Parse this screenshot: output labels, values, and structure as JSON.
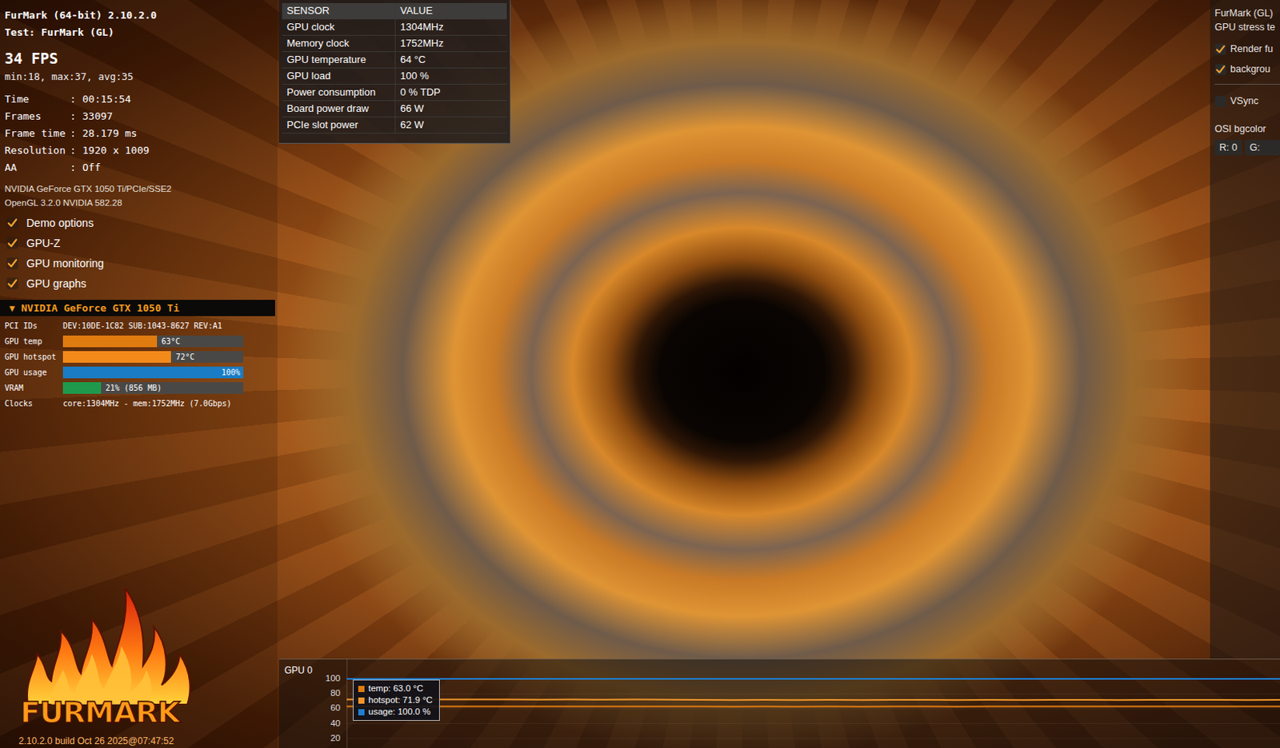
{
  "window": {
    "title": "FurMark (64-bit) 2.10.2.0",
    "test": "Test: FurMark (GL)"
  },
  "stats": {
    "fps": "34 FPS",
    "summary": "min:18, max:37, avg:35",
    "separator": ":",
    "rows": [
      {
        "label": "Time",
        "value": "00:15:54"
      },
      {
        "label": "Frames",
        "value": "33097"
      },
      {
        "label": "Frame time",
        "value": "28.179 ms"
      },
      {
        "label": "Resolution",
        "value": "1920 x 1009"
      },
      {
        "label": "AA",
        "value": "Off"
      }
    ]
  },
  "gpu_info": [
    "NVIDIA GeForce GTX 1050 Ti/PCIe/SSE2",
    "OpenGL 3.2.0 NVIDIA 582.28"
  ],
  "options": [
    {
      "label": "Demo options",
      "checked": true
    },
    {
      "label": "GPU-Z",
      "checked": true
    },
    {
      "label": "GPU monitoring",
      "checked": true
    },
    {
      "label": "GPU graphs",
      "checked": true
    }
  ],
  "gpu_panel": {
    "expand_icon": "▼",
    "title": "NVIDIA GeForce GTX 1050 Ti",
    "pci": {
      "label": "PCI IDs",
      "value": "DEV:10DE-1C82 SUB:1043-8627 REV:A1"
    },
    "bars": [
      {
        "label": "GPU temp",
        "reading": "63°C",
        "level": 0.52,
        "color": "#e07b10"
      },
      {
        "label": "GPU hotspot",
        "reading": "72°C",
        "level": 0.6,
        "color": "#f28a1a"
      },
      {
        "label": "GPU usage",
        "reading": "100%",
        "level": 1.0,
        "color": "#1a7cc4"
      },
      {
        "label": "VRAM",
        "reading": "21% (856 MB)",
        "level": 0.21,
        "color": "#1e9a4c"
      }
    ],
    "clocks": {
      "label": "Clocks",
      "value": "core:1304MHz - mem:1752MHz (7.0Gbps)"
    }
  },
  "sensors": {
    "columns": [
      "SENSOR",
      "VALUE"
    ],
    "rows": [
      {
        "sensor": "GPU clock",
        "value": "1304MHz"
      },
      {
        "sensor": "Memory clock",
        "value": "1752MHz"
      },
      {
        "sensor": "GPU temperature",
        "value": "64 °C"
      },
      {
        "sensor": "GPU load",
        "value": "100 %"
      },
      {
        "sensor": "Power consumption",
        "value": "0 % TDP"
      },
      {
        "sensor": "Board power draw",
        "value": "66 W"
      },
      {
        "sensor": "PCIe slot power",
        "value": "62 W"
      }
    ]
  },
  "side_panel": {
    "title": "FurMark (GL)",
    "subtitle": "GPU stress te",
    "checks": [
      {
        "label": "Render fu",
        "checked": true
      },
      {
        "label": "backgrou",
        "checked": true
      },
      {
        "label": "VSync",
        "checked": false
      }
    ],
    "bgcolor": {
      "label": "OSI bgcolor",
      "fields": [
        "R: 0",
        "G:"
      ]
    }
  },
  "graph": {
    "title": "GPU 0",
    "ticks": [
      "100",
      "80",
      "60",
      "40",
      "20"
    ],
    "series": [
      {
        "name": "hotspot",
        "color": "#f0962a",
        "values": [
          72.2,
          72.3,
          72.1,
          72.4,
          72.2,
          72.3,
          72.1,
          72.2,
          72.0,
          72.3,
          72.1,
          71.7,
          71.6,
          71.8,
          71.5,
          71.7,
          71.6,
          71.8,
          71.7,
          71.5,
          71.9,
          71.6,
          71.7,
          71.8,
          71.6,
          71.9,
          71.7,
          71.8,
          71.6,
          71.9
        ]
      },
      {
        "name": "temp",
        "color": "#e07b10",
        "values": [
          63.0,
          63.1,
          63.0,
          62.9,
          63.0,
          63.1,
          63.0,
          63.0,
          62.9,
          63.0,
          63.1,
          62.8,
          62.7,
          62.8,
          62.6,
          62.8,
          62.7,
          62.9,
          62.8,
          62.7,
          63.0,
          62.8,
          62.9,
          63.0,
          62.8,
          63.0,
          62.9,
          63.0,
          62.9,
          63.0
        ]
      },
      {
        "name": "usage",
        "color": "#1f7fd0",
        "values": [
          100,
          100,
          100,
          100,
          100,
          100,
          100,
          100,
          100,
          100,
          100,
          100,
          100,
          100,
          100,
          100,
          100,
          100,
          100,
          100,
          100,
          100,
          100,
          100,
          100,
          100,
          100,
          100,
          100,
          100
        ]
      }
    ],
    "tooltip": [
      {
        "text": "temp: 63.0 °C",
        "color": "#e07b10"
      },
      {
        "text": "hotspot: 71.9 °C",
        "color": "#f0962a"
      },
      {
        "text": "usage: 100.0 %",
        "color": "#1f7fd0"
      }
    ]
  },
  "logo": {
    "text": "FURMARK",
    "build": "2.10.2.0 build Oct 26 2025@07:47:52"
  }
}
